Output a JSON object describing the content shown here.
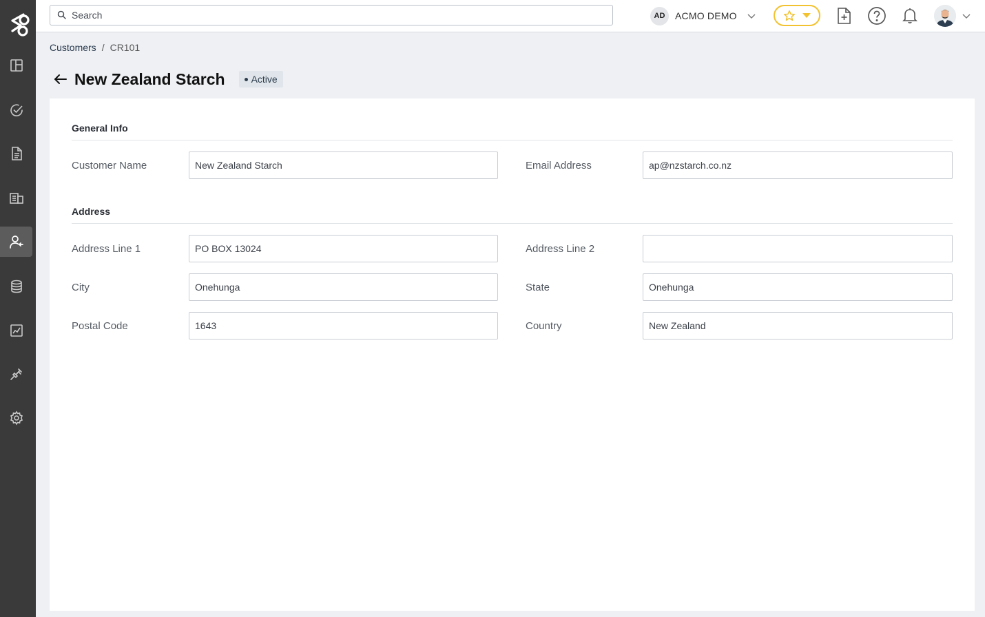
{
  "app": {
    "logo": "app-logo"
  },
  "sidebar": {
    "items": [
      {
        "icon": "dashboard-icon",
        "active": false
      },
      {
        "icon": "check-circle-icon",
        "active": false
      },
      {
        "icon": "document-icon",
        "active": false
      },
      {
        "icon": "building-icon",
        "active": false
      },
      {
        "icon": "customers-icon",
        "active": true
      },
      {
        "icon": "database-icon",
        "active": false
      },
      {
        "icon": "chart-icon",
        "active": false
      },
      {
        "icon": "plug-icon",
        "active": false
      },
      {
        "icon": "settings-icon",
        "active": false
      }
    ]
  },
  "header": {
    "search": {
      "placeholder": "Search",
      "value": ""
    },
    "org": {
      "initials": "AD",
      "name": "ACMO DEMO"
    }
  },
  "breadcrumb": {
    "parent": "Customers",
    "separator": "/",
    "current": "CR101"
  },
  "page": {
    "title": "New Zealand Starch",
    "status": "Active"
  },
  "sections": {
    "general": {
      "title": "General Info",
      "customer_name": {
        "label": "Customer Name",
        "value": "New Zealand Starch"
      },
      "email": {
        "label": "Email Address",
        "value": "ap@nzstarch.co.nz"
      }
    },
    "address": {
      "title": "Address",
      "line1": {
        "label": "Address Line 1",
        "value": "PO BOX 13024"
      },
      "line2": {
        "label": "Address Line 2",
        "value": ""
      },
      "city": {
        "label": "City",
        "value": "Onehunga"
      },
      "state": {
        "label": "State",
        "value": "Onehunga"
      },
      "postal": {
        "label": "Postal Code",
        "value": "1643"
      },
      "country": {
        "label": "Country",
        "value": "New Zealand"
      }
    }
  },
  "colors": {
    "sidebar_bg": "#3a3a3a",
    "sidebar_active": "#5c5c5c",
    "accent_star": "#f2c230",
    "badge_bg": "#dfe5ea"
  }
}
